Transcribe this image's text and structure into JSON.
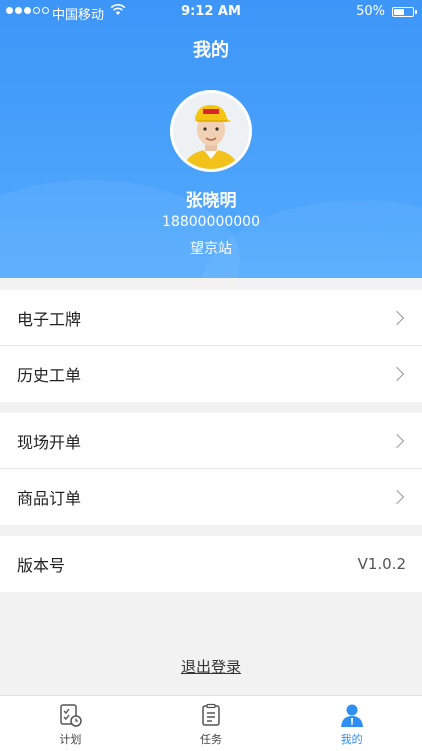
{
  "status_bar": {
    "carrier": "中国移动",
    "time": "9:12 AM",
    "battery": "50%"
  },
  "header": {
    "title": "我的"
  },
  "profile": {
    "name": "张晓明",
    "phone": "18800000000",
    "station": "望京站"
  },
  "menu": {
    "group1": [
      {
        "label": "电子工牌"
      },
      {
        "label": "历史工单"
      }
    ],
    "group2": [
      {
        "label": "现场开单"
      },
      {
        "label": "商品订单"
      }
    ],
    "version_label": "版本号",
    "version_value": "V1.0.2"
  },
  "logout_label": "退出登录",
  "tabs": [
    {
      "label": "计划",
      "icon": "plan-icon"
    },
    {
      "label": "任务",
      "icon": "task-icon"
    },
    {
      "label": "我的",
      "icon": "profile-icon"
    }
  ],
  "colors": {
    "accent": "#3d95f7",
    "active_tab": "#2f8ef2"
  }
}
